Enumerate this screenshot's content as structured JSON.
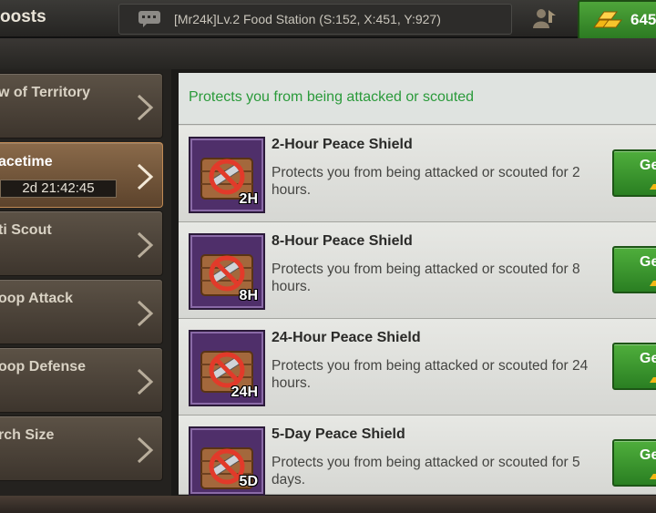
{
  "header": {
    "title": "oosts",
    "chat_text": "[Mr24k]Lv.2 Food Station (S:152, X:451, Y:927)",
    "gold_amount": "645",
    "accent_green": "#2c7a22"
  },
  "sidebar": {
    "items": [
      {
        "label": "w of Territory",
        "timer": null,
        "active": false
      },
      {
        "label": "acetime",
        "timer": "2d 21:42:45",
        "active": true
      },
      {
        "label": "ti Scout",
        "timer": null,
        "active": false
      },
      {
        "label": "oop Attack",
        "timer": null,
        "active": false
      },
      {
        "label": "oop Defense",
        "timer": null,
        "active": false
      },
      {
        "label": "rch Size",
        "timer": null,
        "active": false
      }
    ]
  },
  "main": {
    "banner_text": "Protects you from being attacked or scouted",
    "items": [
      {
        "name": "2-Hour Peace Shield",
        "description": "Protects you from being attacked or scouted for 2 hours.",
        "duration": "2H",
        "button": "Ge"
      },
      {
        "name": "8-Hour Peace Shield",
        "description": "Protects you from being attacked or scouted for 8 hours.",
        "duration": "8H",
        "button": "Ge"
      },
      {
        "name": "24-Hour Peace Shield",
        "description": "Protects you from being attacked or scouted for 24 hours.",
        "duration": "24H",
        "button": "Ge"
      },
      {
        "name": "5-Day Peace Shield",
        "description": "Protects you from being attacked or scouted for 5 days.",
        "duration": "5D",
        "button": "Ge"
      }
    ]
  }
}
